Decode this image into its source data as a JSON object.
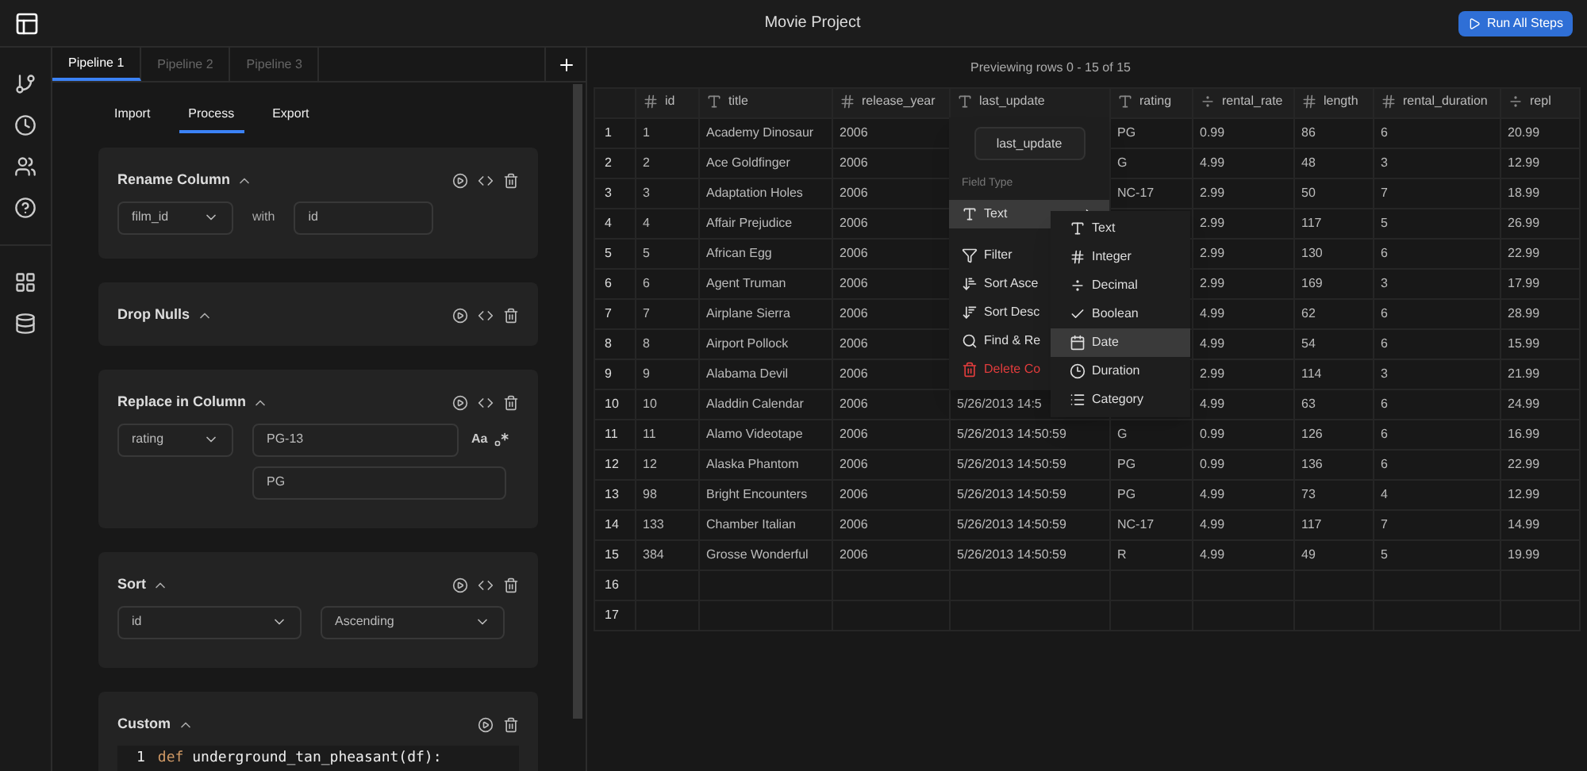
{
  "app": {
    "title": "Movie Project",
    "run_button": "Run All Steps"
  },
  "pipeline_tabs": [
    {
      "label": "Pipeline 1",
      "selected": true
    },
    {
      "label": "Pipeline 2",
      "selected": false
    },
    {
      "label": "Pipeline 3",
      "selected": false
    }
  ],
  "step_tabs": [
    {
      "label": "Import",
      "selected": false
    },
    {
      "label": "Process",
      "selected": true
    },
    {
      "label": "Export",
      "selected": false
    }
  ],
  "steps": [
    {
      "kind": "rename",
      "title": "Rename Column",
      "expanded": true,
      "code_toggle": true,
      "column": "film_id",
      "joiner": "with",
      "value": "id"
    },
    {
      "kind": "drop_nulls",
      "title": "Drop Nulls",
      "expanded": true,
      "code_toggle": true
    },
    {
      "kind": "replace",
      "title": "Replace in Column",
      "expanded": true,
      "code_toggle": true,
      "column": "rating",
      "find": "PG-13",
      "replace": "PG",
      "match_case": "Aa"
    },
    {
      "kind": "sort",
      "title": "Sort",
      "expanded": true,
      "code_toggle": true,
      "column": "id",
      "order": "Ascending"
    },
    {
      "kind": "custom",
      "title": "Custom",
      "expanded": true,
      "code_toggle": false,
      "code_lines": [
        {
          "number": "1",
          "keyword": "def",
          "rest": "underground_tan_pheasant(df):"
        }
      ]
    }
  ],
  "preview": {
    "caption": "Previewing rows 0 - 15 of 15",
    "columns": [
      {
        "name": "id",
        "kind": "integer"
      },
      {
        "name": "title",
        "kind": "text"
      },
      {
        "name": "release_year",
        "kind": "integer"
      },
      {
        "name": "last_update",
        "kind": "text"
      },
      {
        "name": "rating",
        "kind": "text"
      },
      {
        "name": "rental_rate",
        "kind": "decimal"
      },
      {
        "name": "length",
        "kind": "integer"
      },
      {
        "name": "rental_duration",
        "kind": "integer"
      },
      {
        "name": "repl",
        "kind": "decimal"
      }
    ],
    "rows": [
      {
        "number": "1",
        "cells": [
          "1",
          "Academy Dinosaur",
          "2006",
          null,
          "PG",
          "0.99",
          "86",
          "6",
          "20.99"
        ]
      },
      {
        "number": "2",
        "cells": [
          "2",
          "Ace Goldfinger",
          "2006",
          null,
          "G",
          "4.99",
          "48",
          "3",
          "12.99"
        ]
      },
      {
        "number": "3",
        "cells": [
          "3",
          "Adaptation Holes",
          "2006",
          null,
          "NC-17",
          "2.99",
          "50",
          "7",
          "18.99"
        ]
      },
      {
        "number": "4",
        "cells": [
          "4",
          "Affair Prejudice",
          "2006",
          null,
          null,
          "2.99",
          "117",
          "5",
          "26.99"
        ]
      },
      {
        "number": "5",
        "cells": [
          "5",
          "African Egg",
          "2006",
          null,
          null,
          "2.99",
          "130",
          "6",
          "22.99"
        ]
      },
      {
        "number": "6",
        "cells": [
          "6",
          "Agent Truman",
          "2006",
          null,
          null,
          "2.99",
          "169",
          "3",
          "17.99"
        ]
      },
      {
        "number": "7",
        "cells": [
          "7",
          "Airplane Sierra",
          "2006",
          null,
          null,
          "4.99",
          "62",
          "6",
          "28.99"
        ]
      },
      {
        "number": "8",
        "cells": [
          "8",
          "Airport Pollock",
          "2006",
          null,
          null,
          "4.99",
          "54",
          "6",
          "15.99"
        ]
      },
      {
        "number": "9",
        "cells": [
          "9",
          "Alabama Devil",
          "2006",
          null,
          null,
          "2.99",
          "114",
          "3",
          "21.99"
        ]
      },
      {
        "number": "10",
        "cells": [
          "10",
          "Aladdin Calendar",
          "2006",
          "5/26/2013 14:5",
          null,
          "4.99",
          "63",
          "6",
          "24.99"
        ]
      },
      {
        "number": "11",
        "cells": [
          "11",
          "Alamo Videotape",
          "2006",
          "5/26/2013 14:50:59",
          "G",
          "0.99",
          "126",
          "6",
          "16.99"
        ]
      },
      {
        "number": "12",
        "cells": [
          "12",
          "Alaska Phantom",
          "2006",
          "5/26/2013 14:50:59",
          "PG",
          "0.99",
          "136",
          "6",
          "22.99"
        ]
      },
      {
        "number": "13",
        "cells": [
          "98",
          "Bright Encounters",
          "2006",
          "5/26/2013 14:50:59",
          "PG",
          "4.99",
          "73",
          "4",
          "12.99"
        ]
      },
      {
        "number": "14",
        "cells": [
          "133",
          "Chamber Italian",
          "2006",
          "5/26/2013 14:50:59",
          "NC-17",
          "4.99",
          "117",
          "7",
          "14.99"
        ]
      },
      {
        "number": "15",
        "cells": [
          "384",
          "Grosse Wonderful",
          "2006",
          "5/26/2013 14:50:59",
          "R",
          "4.99",
          "49",
          "5",
          "19.99"
        ]
      },
      {
        "number": "16",
        "cells": []
      },
      {
        "number": "17",
        "cells": []
      }
    ]
  },
  "column_menu": {
    "field_name": "last_update",
    "section_label": "Field Type",
    "current_type": {
      "label": "Text",
      "kind": "text",
      "expanded": true
    },
    "items": [
      {
        "kind": "filter",
        "label": "Filter"
      },
      {
        "kind": "sort_asc",
        "label": "Sort Asce"
      },
      {
        "kind": "sort_desc",
        "label": "Sort Desc"
      },
      {
        "kind": "find",
        "label": "Find & Re"
      },
      {
        "kind": "delete",
        "label": "Delete Co"
      }
    ],
    "type_options": [
      {
        "kind": "text",
        "label": "Text",
        "selected": false
      },
      {
        "kind": "integer",
        "label": "Integer",
        "selected": false
      },
      {
        "kind": "decimal",
        "label": "Decimal",
        "selected": false
      },
      {
        "kind": "boolean",
        "label": "Boolean",
        "selected": false
      },
      {
        "kind": "date",
        "label": "Date",
        "selected": true
      },
      {
        "kind": "duration",
        "label": "Duration",
        "selected": false
      },
      {
        "kind": "category",
        "label": "Category",
        "selected": false
      }
    ]
  }
}
